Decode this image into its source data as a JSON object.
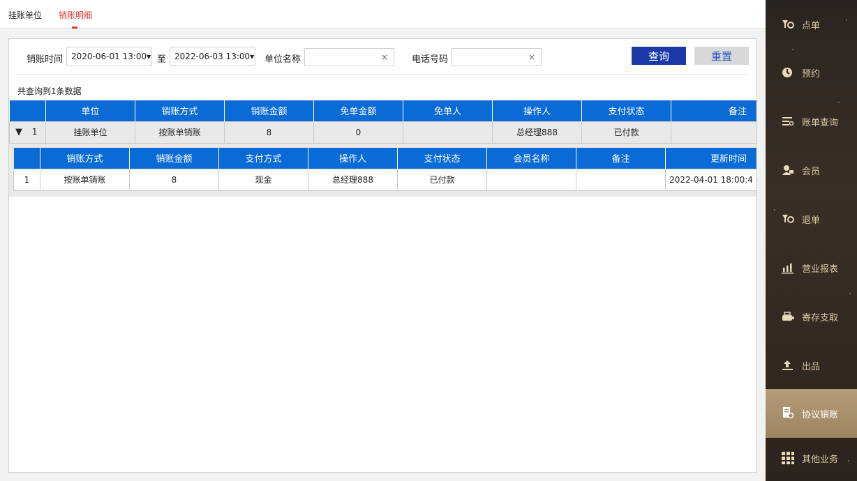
{
  "tabs": [
    {
      "label": "挂账单位"
    },
    {
      "label": "销账明细"
    }
  ],
  "filters": {
    "time_label": "销账时间",
    "start": "2020-06-01 13:00▾",
    "separator": "至",
    "end": "2022-06-03 13:00▾",
    "unit_label": "单位名称",
    "unit_value": "",
    "phone_label": "电话号码",
    "phone_value": "",
    "clear_symbol": "×",
    "query_label": "查询",
    "reset_label": "重置"
  },
  "result_count": "共查询到1条数据",
  "outer_table": {
    "headers": [
      "",
      "单位",
      "销账方式",
      "销账金额",
      "免单金额",
      "免单人",
      "操作人",
      "支付状态",
      "备注"
    ],
    "rows": [
      {
        "toggle": "▼",
        "index": "1",
        "unit": "挂账单位",
        "method": "按账单销账",
        "amount": "8",
        "free_amount": "0",
        "free_person": "",
        "operator": "总经理888",
        "pay_status": "已付款",
        "remark": ""
      }
    ]
  },
  "inner_table": {
    "headers": [
      "",
      "销账方式",
      "销账金额",
      "支付方式",
      "操作人",
      "支付状态",
      "会员名称",
      "备注",
      "更新时间"
    ],
    "rows": [
      {
        "index": "1",
        "method": "按账单销账",
        "amount": "8",
        "pay_method": "现金",
        "operator": "总经理888",
        "pay_status": "已付款",
        "member": "",
        "remark": "",
        "updated": "2022-04-01 18:00:4"
      }
    ]
  },
  "sidebar": {
    "items": [
      {
        "label": "点单",
        "icon": "order-icon"
      },
      {
        "label": "预约",
        "icon": "clock-icon"
      },
      {
        "label": "账单查询",
        "icon": "bill-list-icon"
      },
      {
        "label": "会员",
        "icon": "member-icon"
      },
      {
        "label": "退单",
        "icon": "refund-icon"
      },
      {
        "label": "营业报表",
        "icon": "report-icon"
      },
      {
        "label": "寄存支取",
        "icon": "storage-icon"
      },
      {
        "label": "出品",
        "icon": "dispatch-icon"
      },
      {
        "label": "协议销账",
        "icon": "agreement-icon",
        "active": true
      },
      {
        "label": "其他业务",
        "icon": "grid-icon"
      }
    ]
  },
  "colors": {
    "accent_red": "#e23b3b",
    "header_blue": "#0a6bd6",
    "query_button": "#1b3aa8",
    "sidebar_bg": "#2a2420",
    "sidebar_active": "#b59c77",
    "sidebar_text": "#d9c7a3"
  }
}
